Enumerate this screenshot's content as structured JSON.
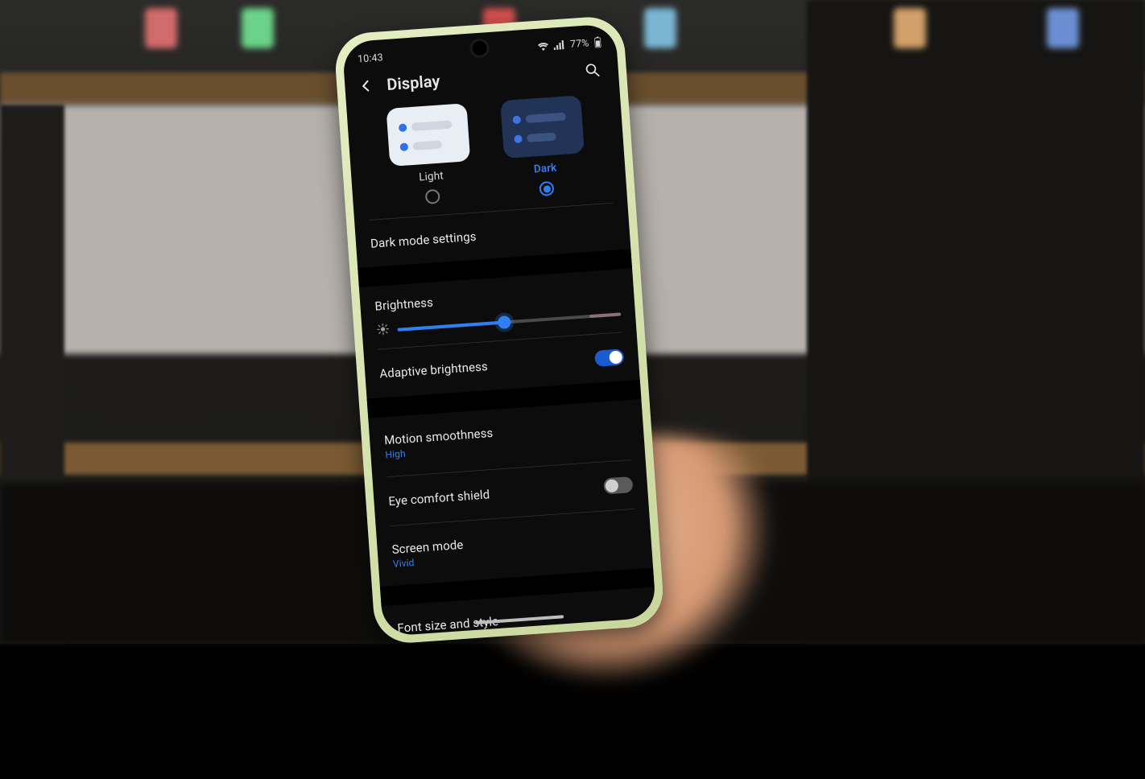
{
  "status_bar": {
    "time": "10:43",
    "battery_text": "77%"
  },
  "header": {
    "title": "Display"
  },
  "theme": {
    "options": [
      {
        "label": "Light",
        "selected": false
      },
      {
        "label": "Dark",
        "selected": true
      }
    ]
  },
  "settings": {
    "dark_mode_settings": {
      "label": "Dark mode settings"
    },
    "brightness": {
      "label": "Brightness",
      "percent": 48
    },
    "adaptive_brightness": {
      "label": "Adaptive brightness",
      "on": true
    },
    "motion_smoothness": {
      "label": "Motion smoothness",
      "value": "High"
    },
    "eye_comfort_shield": {
      "label": "Eye comfort shield",
      "on": false
    },
    "screen_mode": {
      "label": "Screen mode",
      "value": "Vivid"
    },
    "font_size_style": {
      "label": "Font size and style"
    }
  },
  "colors": {
    "accent": "#2e7ff1"
  }
}
